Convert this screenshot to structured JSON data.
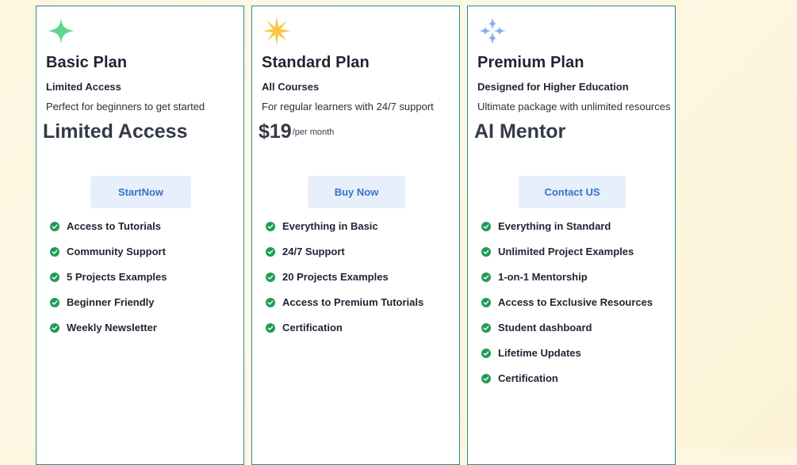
{
  "colors": {
    "background": "#fdf6e0",
    "card_border": "#2c8c8c",
    "button_bg": "#e6effb",
    "button_text": "#3a73c6",
    "check": "#1f9d55"
  },
  "plans": [
    {
      "icon": "green-sparkle-icon",
      "title": "Basic Plan",
      "subtitle": "Limited Access",
      "description": "Perfect for beginners to get started",
      "price_text": "Limited Access",
      "button_label": "StartNow",
      "features": [
        "Access to Tutorials",
        "Community Support",
        "5 Projects Examples",
        "Beginner Friendly",
        "Weekly Newsletter"
      ]
    },
    {
      "icon": "yellow-star-icon",
      "title": "Standard Plan",
      "subtitle": "All Courses",
      "description": "For regular learners with 24/7 support",
      "price_amount": "$19",
      "price_period": "/per month",
      "button_label": "Buy Now",
      "features": [
        "Everything in Basic",
        "24/7 Support",
        "20 Projects Examples",
        "Access to Premium Tutorials",
        "Certification"
      ]
    },
    {
      "icon": "blue-sparkles-icon",
      "title": "Premium Plan",
      "subtitle": "Designed for Higher Education",
      "description": "Ultimate package with unlimited resources",
      "price_text": "AI Mentor",
      "button_label": "Contact US",
      "features": [
        "Everything in Standard",
        "Unlimited Project Examples",
        "1-on-1 Mentorship",
        "Access to Exclusive Resources",
        "Student dashboard",
        "Lifetime Updates",
        "Certification"
      ]
    }
  ]
}
